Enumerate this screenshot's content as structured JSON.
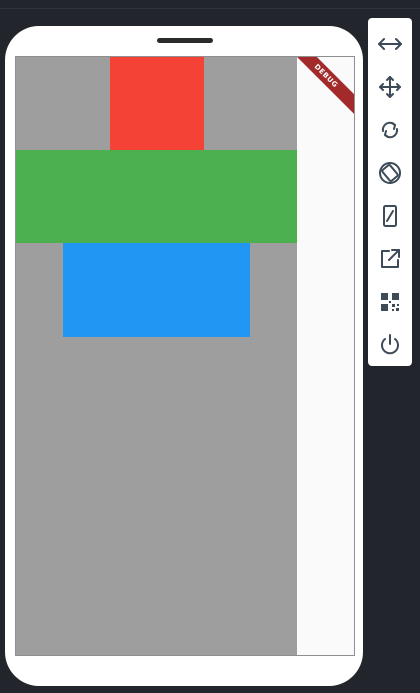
{
  "device": {
    "debug_banner": "DEBUG"
  },
  "app": {
    "background_color": "#9e9e9e",
    "boxes": [
      {
        "name": "red-box",
        "color": "#f44336"
      },
      {
        "name": "green-box",
        "color": "#4caf50"
      },
      {
        "name": "blue-box",
        "color": "#2196f3"
      }
    ]
  },
  "toolbar": {
    "tools": [
      {
        "icon": "resize-horizontal-icon"
      },
      {
        "icon": "move-icon"
      },
      {
        "icon": "rotate-icon"
      },
      {
        "icon": "rotate-device-icon"
      },
      {
        "icon": "resize-device-icon"
      },
      {
        "icon": "open-external-icon"
      },
      {
        "icon": "qr-code-icon"
      },
      {
        "icon": "power-icon"
      }
    ]
  }
}
